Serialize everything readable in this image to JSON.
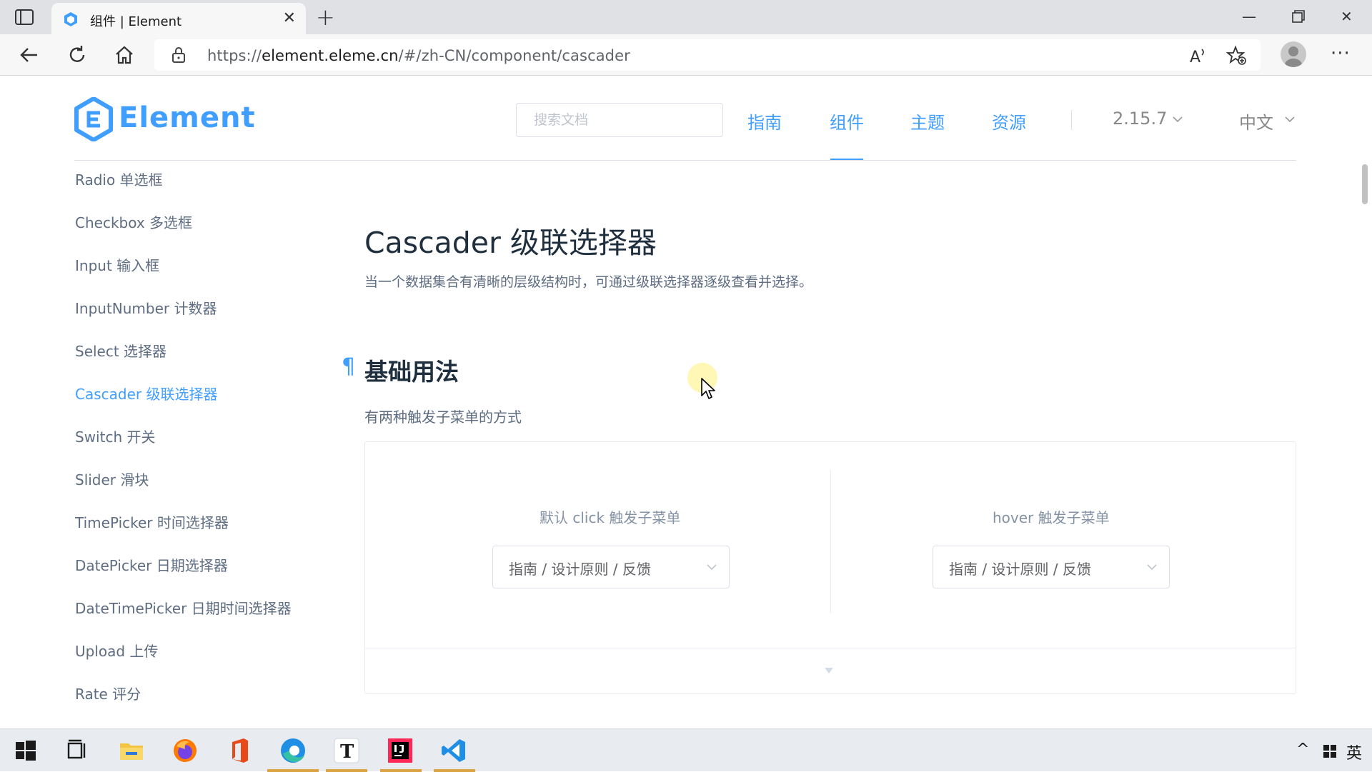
{
  "browser": {
    "tab_title": "组件 | Element",
    "url_prefix": "https://",
    "url_host": "element.eleme.cn",
    "url_path": "/#/zh-CN/component/cascader"
  },
  "header": {
    "logo_text": "Element",
    "search_placeholder": "搜索文档",
    "nav": [
      "指南",
      "组件",
      "主题",
      "资源"
    ],
    "active_nav": "组件",
    "version": "2.15.7",
    "language": "中文"
  },
  "sidebar": {
    "items": [
      {
        "label": "Radio 单选框"
      },
      {
        "label": "Checkbox 多选框"
      },
      {
        "label": "Input 输入框"
      },
      {
        "label": "InputNumber 计数器"
      },
      {
        "label": "Select 选择器"
      },
      {
        "label": "Cascader 级联选择器"
      },
      {
        "label": "Switch 开关"
      },
      {
        "label": "Slider 滑块"
      },
      {
        "label": "TimePicker 时间选择器"
      },
      {
        "label": "DatePicker 日期选择器"
      },
      {
        "label": "DateTimePicker 日期时间选择器"
      },
      {
        "label": "Upload 上传"
      },
      {
        "label": "Rate 评分"
      }
    ],
    "active_item": "Cascader 级联选择器"
  },
  "main": {
    "title": "Cascader 级联选择器",
    "lead": "当一个数据集合有清晰的层级结构时，可通过级联选择器逐级查看并选择。",
    "section_anchor": "¶",
    "section_title": "基础用法",
    "section_desc": "有两种触发子菜单的方式",
    "demo": {
      "left_label": "默认 click 触发子菜单",
      "left_value": "指南 / 设计原则 / 反馈",
      "right_label": "hover 触发子菜单",
      "right_value": "指南 / 设计原则 / 反馈"
    }
  },
  "taskbar": {
    "apps": [
      "start-icon",
      "task-view-icon",
      "file-explorer-icon",
      "firefox-icon",
      "office-icon",
      "edge-icon",
      "typora-icon",
      "intellij-icon",
      "vscode-icon"
    ],
    "tray_caret": "^",
    "tray_ime_mode": "英"
  },
  "colors": {
    "accent": "#409eff",
    "text_primary": "#1f2f3d",
    "text_secondary": "#5e6d82"
  }
}
